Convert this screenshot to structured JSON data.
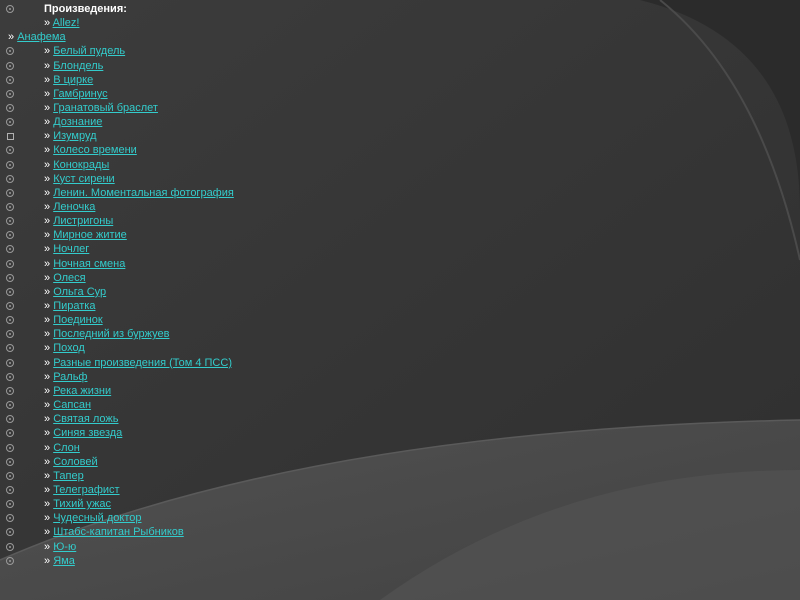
{
  "heading": "Произведения:",
  "raquo": "»",
  "items": [
    {
      "label": "Allez!",
      "bullet": "none",
      "indent": false
    },
    {
      "label": "Анафема",
      "bullet": "none",
      "indent": true
    },
    {
      "label": "Белый пудель",
      "bullet": "target",
      "indent": false
    },
    {
      "label": "Блондель",
      "bullet": "target",
      "indent": false
    },
    {
      "label": "В цирке",
      "bullet": "target",
      "indent": false
    },
    {
      "label": "Гамбринус",
      "bullet": "target",
      "indent": false
    },
    {
      "label": "Гранатовый браслет",
      "bullet": "target",
      "indent": false
    },
    {
      "label": "Дознание",
      "bullet": "target",
      "indent": false
    },
    {
      "label": "Изумруд",
      "bullet": "square",
      "indent": false
    },
    {
      "label": "Колесо времени",
      "bullet": "target",
      "indent": false
    },
    {
      "label": "Конокрады",
      "bullet": "target",
      "indent": false
    },
    {
      "label": "Куст сирени",
      "bullet": "target",
      "indent": false
    },
    {
      "label": "Ленин. Моментальная фотография",
      "bullet": "target",
      "indent": false
    },
    {
      "label": "Леночка",
      "bullet": "target",
      "indent": false
    },
    {
      "label": "Листригоны",
      "bullet": "target",
      "indent": false
    },
    {
      "label": "Мирное житие",
      "bullet": "target",
      "indent": false
    },
    {
      "label": "Ночлег",
      "bullet": "target",
      "indent": false
    },
    {
      "label": "Ночная смена",
      "bullet": "target",
      "indent": false
    },
    {
      "label": "Олеся",
      "bullet": "target",
      "indent": false
    },
    {
      "label": "Ольга Сур",
      "bullet": "target",
      "indent": false
    },
    {
      "label": "Пиратка",
      "bullet": "target",
      "indent": false
    },
    {
      "label": "Поединок",
      "bullet": "target",
      "indent": false
    },
    {
      "label": "Последний из буржуев",
      "bullet": "target",
      "indent": false
    },
    {
      "label": "Поход",
      "bullet": "target",
      "indent": false
    },
    {
      "label": "Разные произведения (Том 4 ПСС)",
      "bullet": "target",
      "indent": false
    },
    {
      "label": "Ральф",
      "bullet": "target",
      "indent": false
    },
    {
      "label": "Река жизни",
      "bullet": "target",
      "indent": false
    },
    {
      "label": "Сапсан",
      "bullet": "target",
      "indent": false
    },
    {
      "label": "Святая ложь",
      "bullet": "target",
      "indent": false
    },
    {
      "label": "Синяя звезда",
      "bullet": "target",
      "indent": false
    },
    {
      "label": "Слон",
      "bullet": "target",
      "indent": false
    },
    {
      "label": "Соловей",
      "bullet": "target",
      "indent": false
    },
    {
      "label": "Тапер",
      "bullet": "target",
      "indent": false
    },
    {
      "label": "Телеграфист",
      "bullet": "target",
      "indent": false
    },
    {
      "label": "Тихий ужас",
      "bullet": "target",
      "indent": false
    },
    {
      "label": "Чудесный доктор",
      "bullet": "target",
      "indent": false
    },
    {
      "label": "Штабс-капитан Рыбников",
      "bullet": "target",
      "indent": false
    },
    {
      "label": "Ю-ю",
      "bullet": "target",
      "indent": false
    },
    {
      "label": "Яма",
      "bullet": "target",
      "indent": false
    }
  ],
  "colors": {
    "background": "#3a3a3a",
    "link": "#33cccc",
    "text": "#ffffff"
  }
}
